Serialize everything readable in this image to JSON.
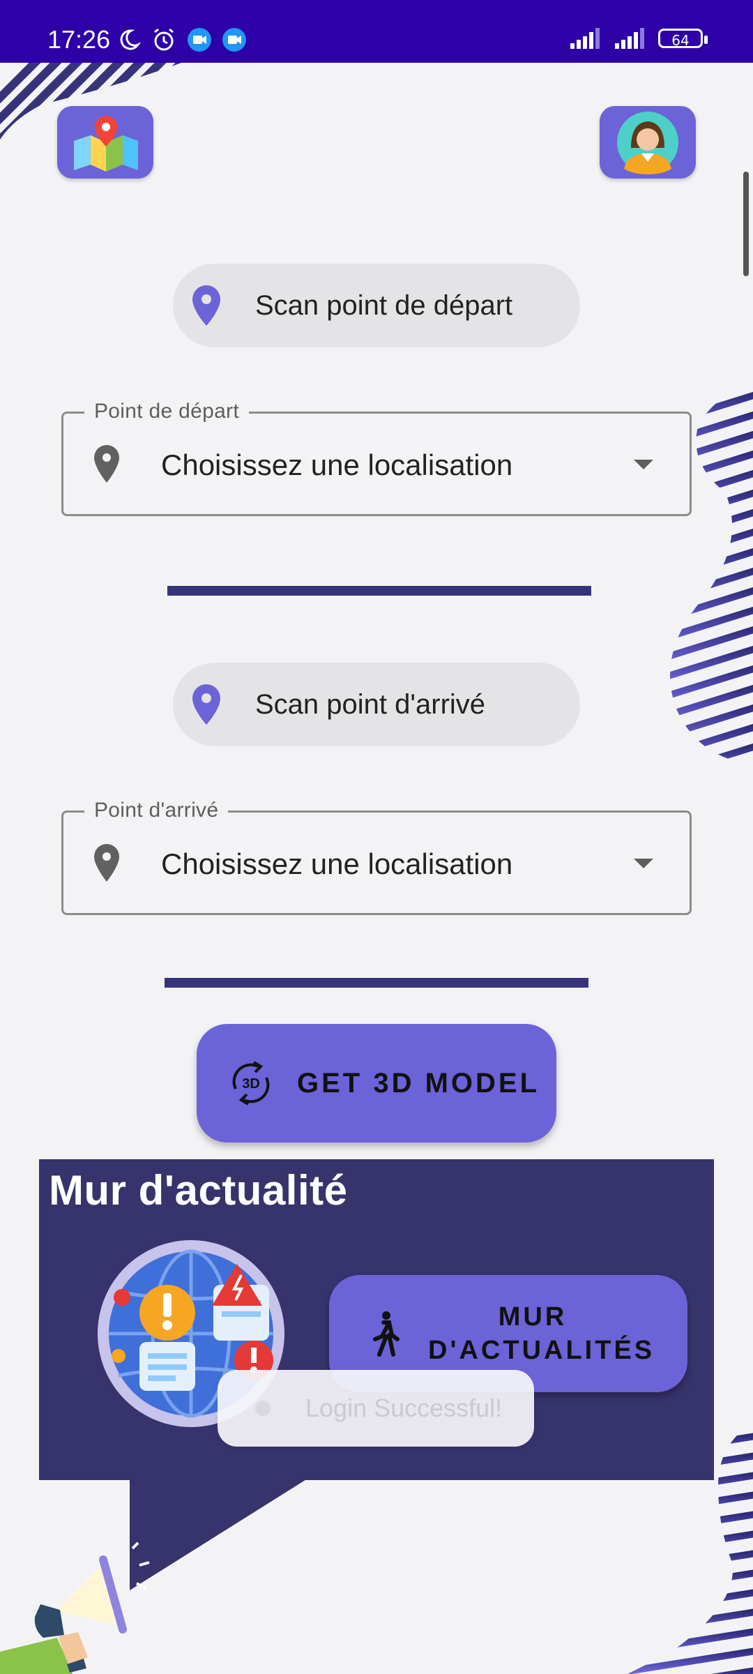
{
  "status_bar": {
    "time": "17:26",
    "battery": "64"
  },
  "header": {
    "map_icon": "map-pin-icon",
    "profile_icon": "user-avatar-icon"
  },
  "departure": {
    "scan_label": "Scan point de départ",
    "field_label": "Point de départ",
    "field_value": "Choisissez une localisation"
  },
  "arrival": {
    "scan_label": "Scan point d'arrivé",
    "field_label": "Point d'arrivé",
    "field_value": "Choisissez une localisation"
  },
  "model_button": {
    "label": "GET 3D MODEL",
    "icon": "3d-rotate-icon"
  },
  "news": {
    "title": "Mur d'actualité",
    "button_label": "MUR D'ACTUALITÉS",
    "button_icon": "walking-person-icon"
  },
  "toast": {
    "message": "Login Successful!"
  },
  "colors": {
    "accent": "#6c63d8",
    "status_bar": "#2d00a8",
    "panel": "#37336c",
    "background": "#f3f3f5"
  }
}
